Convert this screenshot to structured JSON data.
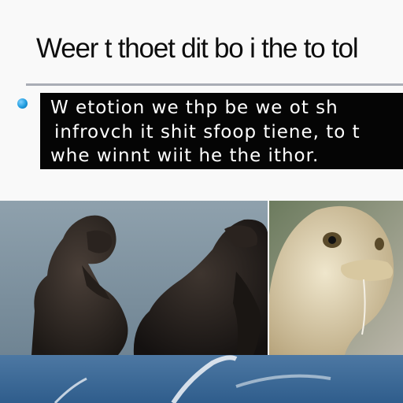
{
  "slide": {
    "title": "Weer t thoet dit bo i the to tol",
    "bullet": {
      "lines": [
        "W etotion we thp be we ot sh",
        "infrovch it shit sfoop tiene, to t",
        "whe winnt wiit he the ithor."
      ]
    }
  },
  "images": [
    {
      "name": "primate-photo",
      "description_icon": "primates-image"
    },
    {
      "name": "creature-photo",
      "description_icon": "creature-image"
    },
    {
      "name": "sky-photo",
      "description_icon": "sky-image"
    }
  ],
  "colors": {
    "title_text": "#0d0d0d",
    "rule": "#a9adb5",
    "bullet_dot": "#1f9bde",
    "text_box_bg": "#050505",
    "text_box_fg": "#ffffff",
    "sky": "#3a6a9a"
  }
}
